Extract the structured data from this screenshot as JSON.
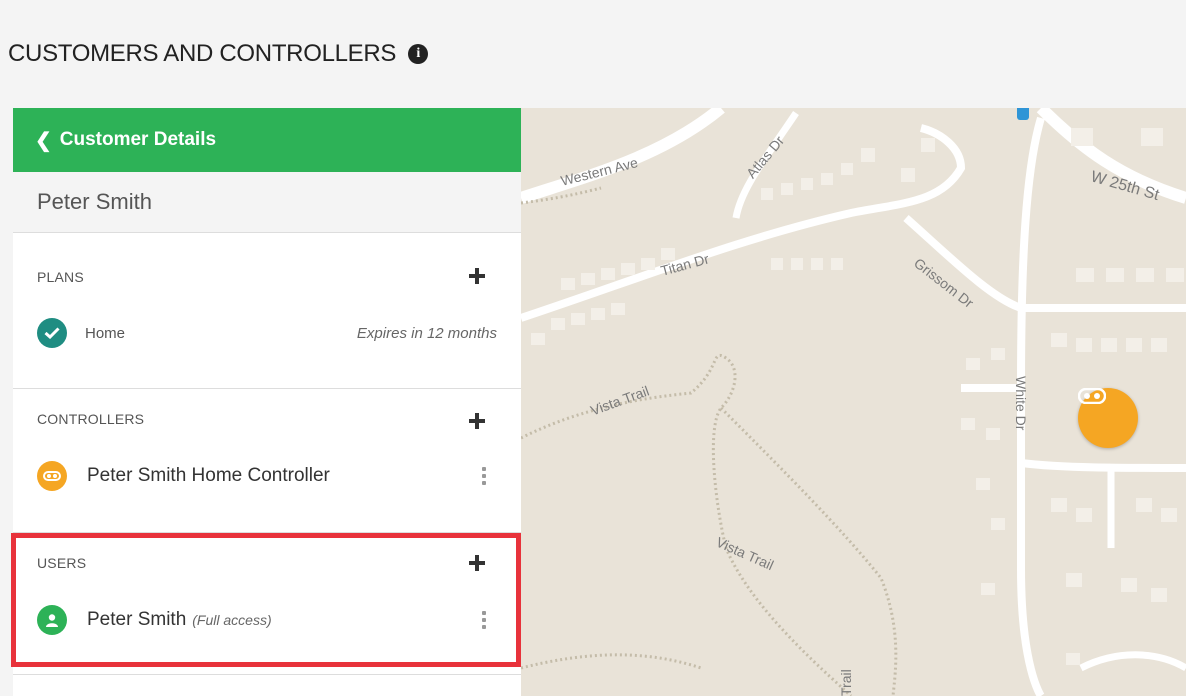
{
  "page": {
    "title": "CUSTOMERS AND CONTROLLERS",
    "info_icon": "info-circle-icon"
  },
  "panel": {
    "back_label": "Customer Details",
    "back_icon": "chevron-left-icon",
    "customer_name": "Peter Smith",
    "plans": {
      "title": "PLANS",
      "items": [
        {
          "label": "Home",
          "status": "Expires in 12 months",
          "icon": "check-circle-icon"
        }
      ]
    },
    "controllers": {
      "title": "CONTROLLERS",
      "items": [
        {
          "label": "Peter Smith Home Controller",
          "icon": "controller-icon"
        }
      ]
    },
    "users": {
      "title": "USERS",
      "items": [
        {
          "label": "Peter Smith",
          "access": "(Full access)",
          "icon": "user-icon"
        }
      ]
    }
  },
  "map": {
    "street_labels": [
      "Western Ave",
      "Atlas Dr",
      "Titan Dr",
      "Grissom Dr",
      "W 25th St",
      "White Dr",
      "Vista Trail",
      "Vista Trail",
      "Trail"
    ],
    "marker_icon": "controller-marker-icon"
  },
  "colors": {
    "accent_green": "#2db257",
    "teal": "#1f8d82",
    "orange": "#f5a623",
    "highlight_red": "#e8323b",
    "map_bg": "#e9e3d8"
  }
}
